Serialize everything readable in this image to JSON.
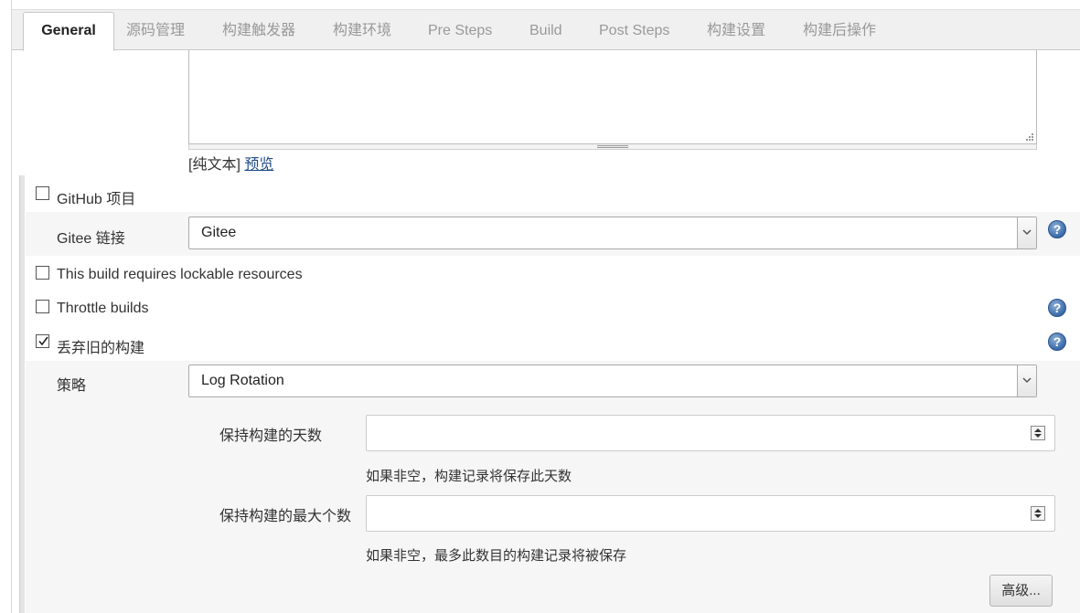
{
  "tabs": [
    {
      "label": "General",
      "active": true
    },
    {
      "label": "源码管理"
    },
    {
      "label": "构建触发器"
    },
    {
      "label": "构建环境"
    },
    {
      "label": "Pre Steps"
    },
    {
      "label": "Build"
    },
    {
      "label": "Post Steps"
    },
    {
      "label": "构建设置"
    },
    {
      "label": "构建后操作"
    }
  ],
  "description": {
    "plain_text_label": "[纯文本]",
    "preview_link": "预览"
  },
  "github_project": {
    "label": "GitHub 项目",
    "checked": false
  },
  "gitee": {
    "label": "Gitee 链接",
    "selected": "Gitee"
  },
  "lockable": {
    "label": "This build requires lockable resources",
    "checked": false
  },
  "throttle": {
    "label": "Throttle builds",
    "checked": false
  },
  "discard_old": {
    "label": "丢弃旧的构建",
    "checked": true
  },
  "strategy": {
    "label": "策略",
    "selected": "Log Rotation"
  },
  "days_to_keep": {
    "label": "保持构建的天数",
    "value": "",
    "hint": "如果非空，构建记录将保存此天数"
  },
  "max_builds": {
    "label": "保持构建的最大个数",
    "value": "",
    "hint": "如果非空，最多此数目的构建记录将被保存"
  },
  "advanced_button": "高级...",
  "help_icon_text": "?",
  "colors": {
    "link": "#204a87",
    "help_icon": "#3a6aa8",
    "tab_strip": "#f0f0f0",
    "shaded_row": "#f6f6f6"
  }
}
